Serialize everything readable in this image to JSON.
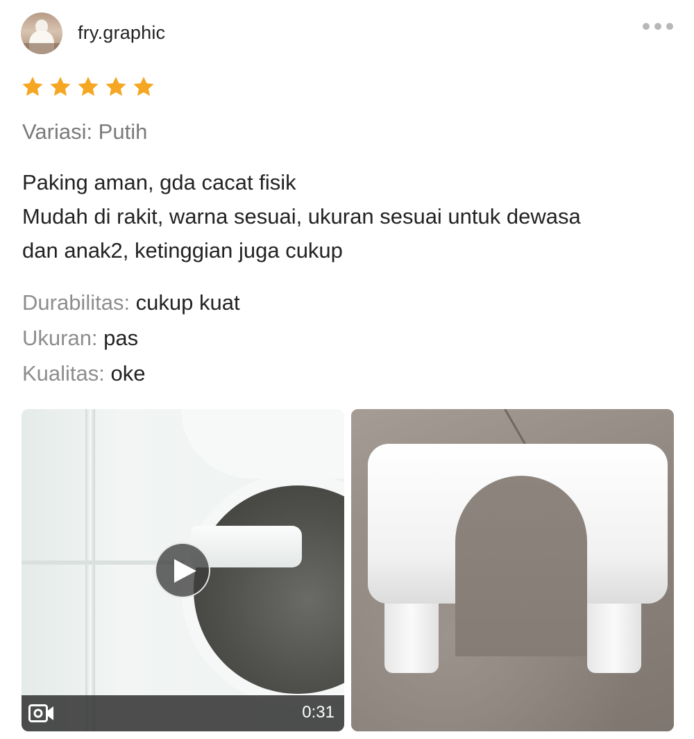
{
  "review": {
    "username": "fry.graphic",
    "rating": 5,
    "rating_max": 5,
    "star_color": "#F5A623",
    "variation": "Variasi: Putih",
    "text_lines": [
      "Paking aman, gda cacat fisik",
      "Mudah di rakit, warna sesuai, ukuran sesuai untuk dewasa",
      "dan anak2, ketinggian juga cukup"
    ],
    "attributes": [
      {
        "key": "Durabilitas:",
        "value": "cukup kuat"
      },
      {
        "key": "Ukuran:",
        "value": "pas"
      },
      {
        "key": "Kualitas:",
        "value": "oke"
      }
    ]
  },
  "media": {
    "video": {
      "duration": "0:31",
      "icon": "video-camera-icon",
      "play_icon": "play-icon"
    },
    "photo": {
      "icon": "image"
    }
  },
  "menu": {
    "icon": "more-horizontal-icon"
  }
}
